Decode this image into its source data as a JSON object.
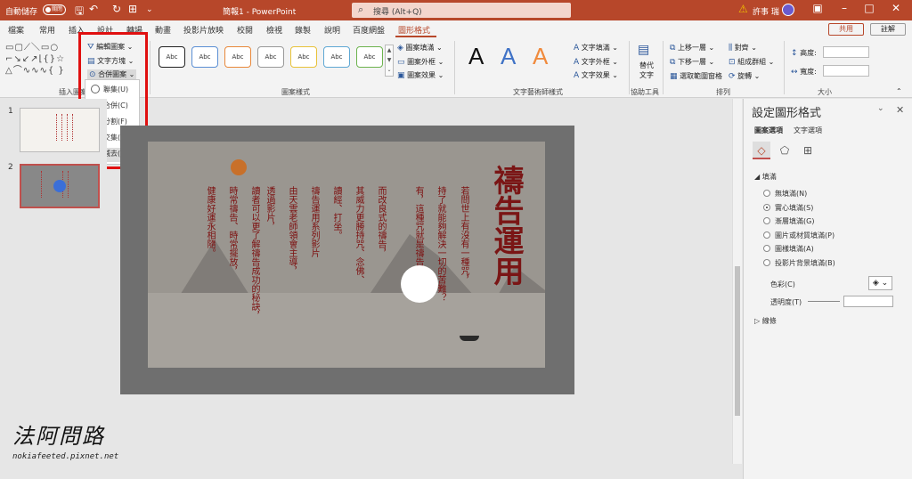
{
  "titlebar": {
    "autosave": "自動儲存",
    "toggle": "關閉",
    "doc_title": "簡報1 - PowerPoint",
    "search": "搜尋 (Alt+Q)",
    "user": "許事 瑞"
  },
  "tabs": [
    "檔案",
    "常用",
    "插入",
    "設計",
    "轉場",
    "動畫",
    "投影片放映",
    "校閱",
    "檢視",
    "錄製",
    "說明",
    "百度網盤",
    "圖形格式"
  ],
  "active_tab": "圖形格式",
  "share_label": "共用",
  "comment_label": "註解",
  "ribbon": {
    "insert_shapes_group": "插入圖案",
    "edit_shape": "編輯圖案",
    "text_box": "文字方塊",
    "merge_shapes": "合併圖案",
    "shape_styles_group": "圖案樣式",
    "style_sample": "Abc",
    "shape_fill": "圖案填滿",
    "shape_outline": "圖案外框",
    "shape_effects": "圖案效果",
    "wordart_sample": "A",
    "text_fill": "文字填滿",
    "text_outline": "文字外框",
    "text_effects": "文字效果",
    "wordart_group": "文字藝術師樣式",
    "alt_text": "替代文字",
    "accessibility_group": "協助工具",
    "bring_forward": "上移一層",
    "send_backward": "下移一層",
    "selection_pane": "選取範圍窗格",
    "align": "對齊",
    "group": "組成群組",
    "rotate": "旋轉",
    "arrange_group": "排列",
    "height": "高度:",
    "width": "寬度:",
    "size_group": "大小"
  },
  "merge_menu": [
    "聯集(U)",
    "合併(C)",
    "分割(F)",
    "交集(I)",
    "減去(S)"
  ],
  "thumbnails": [
    "1",
    "2"
  ],
  "slide": {
    "title": "禱告運用",
    "columns": [
      "若問世上有沒有一種咒，",
      "持了就能夠解決一切的苦難？",
      "有，這種咒就是禱告。",
      "而改良式的禱告，",
      "其威力更勝持咒、念佛、",
      "讀經、打坐。",
      "禱告運用系列影片",
      "由天雲老師領會主導，",
      "透過影片，",
      "讀者可以更了解禱告成功的秘訣，",
      "時常禱告、時常擺放，",
      "健康好運永相隨。"
    ]
  },
  "format_pane": {
    "title": "設定圖形格式",
    "tabs": [
      "圖案選項",
      "文字選項"
    ],
    "fill_section": "填滿",
    "fill_options": [
      "無填滿(N)",
      "實心填滿(S)",
      "漸層填滿(G)",
      "圖片或材質填滿(P)",
      "圖樣填滿(A)",
      "投影片背景填滿(B)"
    ],
    "selected_fill": 1,
    "color_label": "色彩(C)",
    "transparency_label": "透明度(T)",
    "line_section": "線條"
  },
  "watermark": {
    "name": "法阿問路",
    "url": "nokiafeeted.pixnet.net"
  }
}
